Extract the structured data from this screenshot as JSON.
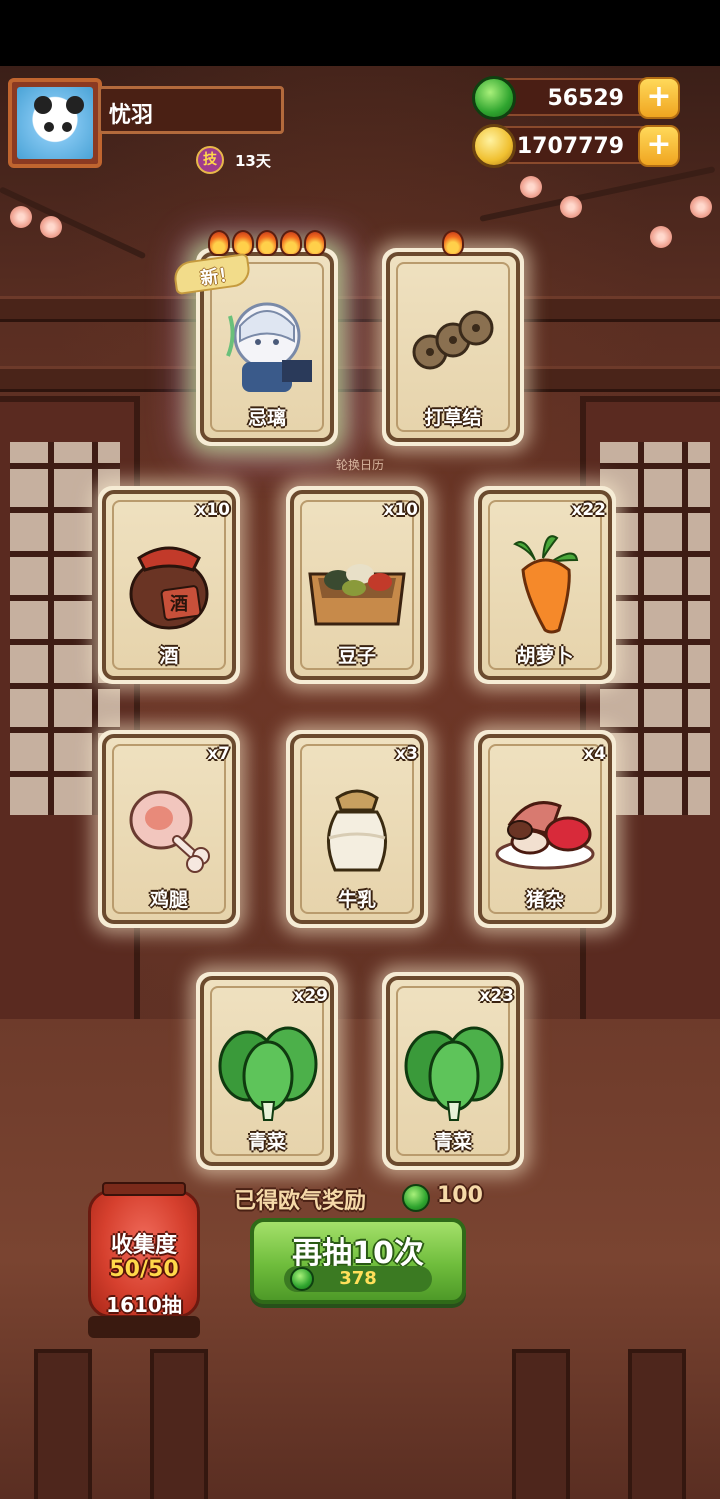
{
  "player": {
    "name": "忧羽",
    "skill_badge": "技",
    "days": "13天"
  },
  "currencies": {
    "jade": {
      "value": "56529",
      "icon": "jade-coin-icon",
      "plus": "+"
    },
    "gold": {
      "value": "1707779",
      "icon": "gold-coin-icon",
      "plus": "+"
    }
  },
  "top_cards": [
    {
      "label": "忌璃",
      "flames": 5,
      "new_badge": "新！",
      "icon": "character-portrait-icon",
      "rare": true
    },
    {
      "label": "打草结",
      "flames": 1,
      "icon": "grass-knot-icon",
      "rare": false
    }
  ],
  "rotation_caption": "轮换日历",
  "item_cards": [
    {
      "label": "酒",
      "qty": "x10",
      "icon": "wine-jar-icon"
    },
    {
      "label": "豆子",
      "qty": "x10",
      "icon": "bean-box-icon"
    },
    {
      "label": "胡萝卜",
      "qty": "x22",
      "icon": "carrot-icon"
    },
    {
      "label": "鸡腿",
      "qty": "x7",
      "icon": "chicken-leg-icon"
    },
    {
      "label": "牛乳",
      "qty": "x3",
      "icon": "milk-jar-icon"
    },
    {
      "label": "猪杂",
      "qty": "x4",
      "icon": "pork-offal-icon"
    },
    {
      "label": "青菜",
      "qty": "x29",
      "icon": "greens-icon"
    },
    {
      "label": "青菜",
      "qty": "x23",
      "icon": "greens-icon"
    }
  ],
  "reward": {
    "text": "已得欧气奖励",
    "value": "100"
  },
  "draw_button": {
    "label": "再抽10次",
    "cost": "378"
  },
  "collection": {
    "title": "收集度",
    "progress": "50/50",
    "draws": "1610抽"
  },
  "colors": {
    "accent_green": "#6fbd3c",
    "gold_plus": "#f0a520",
    "card_bg": "#efe1c0",
    "lantern_red": "#d6402e"
  }
}
